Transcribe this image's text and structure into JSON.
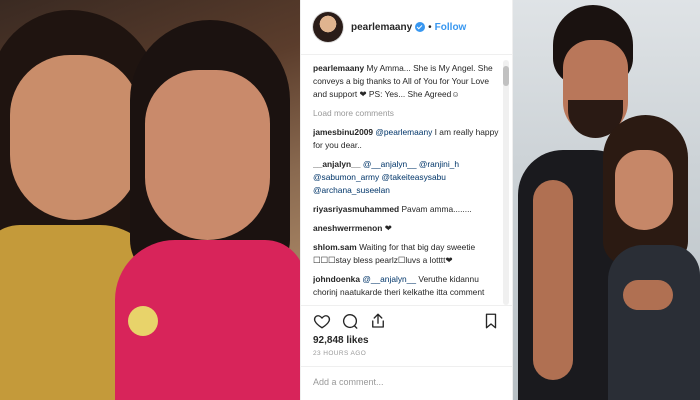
{
  "post": {
    "username": "pearlemaany",
    "follow_label": "Follow",
    "caption_user": "pearlemaany",
    "caption_text": "My Amma... She is My Angel. She conveys a big thanks to All of You for Your Love and support ❤ PS: Yes... She Agreed☺",
    "load_more": "Load more comments",
    "comments": [
      {
        "user": "jamesbinu2009",
        "mention": "@pearlemaany",
        "text": " I am really happy for you dear.."
      },
      {
        "user": "__anjalyn__",
        "mention": "@__anjalyn__ @ranjini_h @sabumon_army @takeiteasysabu @archana_suseelan",
        "text": ""
      },
      {
        "user": "riyasriyasmuhammed",
        "mention": "",
        "text": "Pavam amma........"
      },
      {
        "user": "aneshwerrmenon",
        "mention": "",
        "text": "❤"
      },
      {
        "user": "shlom.sam",
        "mention": "",
        "text": "Waiting for that big day sweetie ☐☐☐stay bless pearlz☐luvs a lotttt❤"
      },
      {
        "user": "johndoenka",
        "mention": "@__anjalyn__",
        "text": " Veruthe kidannu chorinj naatukarde theri kelkathe itta comment eduth kandam vazhi odikkode koche???"
      }
    ],
    "likes": "92,848 likes",
    "time": "23 HOURS AGO",
    "add_comment_placeholder": "Add a comment..."
  }
}
